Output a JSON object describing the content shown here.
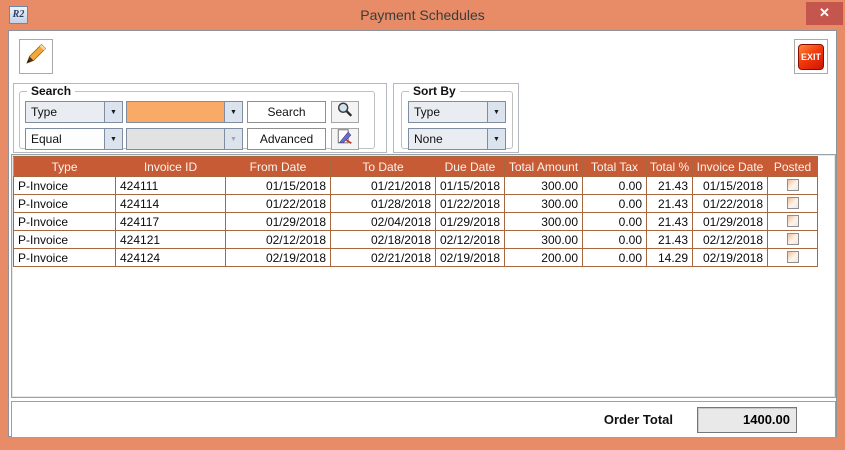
{
  "window": {
    "title": "Payment Schedules",
    "app_icon_text": "R2",
    "close_glyph": "✕"
  },
  "toolbar": {
    "exit_label": "EXIT"
  },
  "search": {
    "legend": "Search",
    "field_combo_value": "Type",
    "operator_combo_value": "Equal",
    "value_combo_value": "",
    "value2_combo_value": "",
    "search_button_label": "Search",
    "advanced_button_label": "Advanced"
  },
  "sort": {
    "legend": "Sort By",
    "primary_combo_value": "Type",
    "secondary_combo_value": "None"
  },
  "table": {
    "columns": [
      "Type",
      "Invoice ID",
      "From Date",
      "To Date",
      "Due Date",
      "Total Amount",
      "Total Tax",
      "Total %",
      "Invoice Date",
      "Posted"
    ],
    "rows": [
      {
        "type": "P-Invoice",
        "invoice_id": "424111",
        "from_date": "01/15/2018",
        "to_date": "01/21/2018",
        "due_date": "01/15/2018",
        "total_amount": "300.00",
        "total_tax": "0.00",
        "total_pct": "21.43",
        "invoice_date": "01/15/2018",
        "posted": false
      },
      {
        "type": "P-Invoice",
        "invoice_id": "424114",
        "from_date": "01/22/2018",
        "to_date": "01/28/2018",
        "due_date": "01/22/2018",
        "total_amount": "300.00",
        "total_tax": "0.00",
        "total_pct": "21.43",
        "invoice_date": "01/22/2018",
        "posted": false
      },
      {
        "type": "P-Invoice",
        "invoice_id": "424117",
        "from_date": "01/29/2018",
        "to_date": "02/04/2018",
        "due_date": "01/29/2018",
        "total_amount": "300.00",
        "total_tax": "0.00",
        "total_pct": "21.43",
        "invoice_date": "01/29/2018",
        "posted": false
      },
      {
        "type": "P-Invoice",
        "invoice_id": "424121",
        "from_date": "02/12/2018",
        "to_date": "02/18/2018",
        "due_date": "02/12/2018",
        "total_amount": "300.00",
        "total_tax": "0.00",
        "total_pct": "21.43",
        "invoice_date": "02/12/2018",
        "posted": false
      },
      {
        "type": "P-Invoice",
        "invoice_id": "424124",
        "from_date": "02/19/2018",
        "to_date": "02/21/2018",
        "due_date": "02/19/2018",
        "total_amount": "200.00",
        "total_tax": "0.00",
        "total_pct": "14.29",
        "invoice_date": "02/19/2018",
        "posted": false
      }
    ]
  },
  "footer": {
    "order_total_label": "Order Total",
    "order_total_value": "1400.00"
  },
  "colors": {
    "titlebar": "#E78C66",
    "close_button": "#C4564E",
    "table_header": "#C75B36",
    "grid_line": "#A8673E",
    "value_field_highlight": "#F8AA66",
    "exit_red": "#E53008"
  }
}
